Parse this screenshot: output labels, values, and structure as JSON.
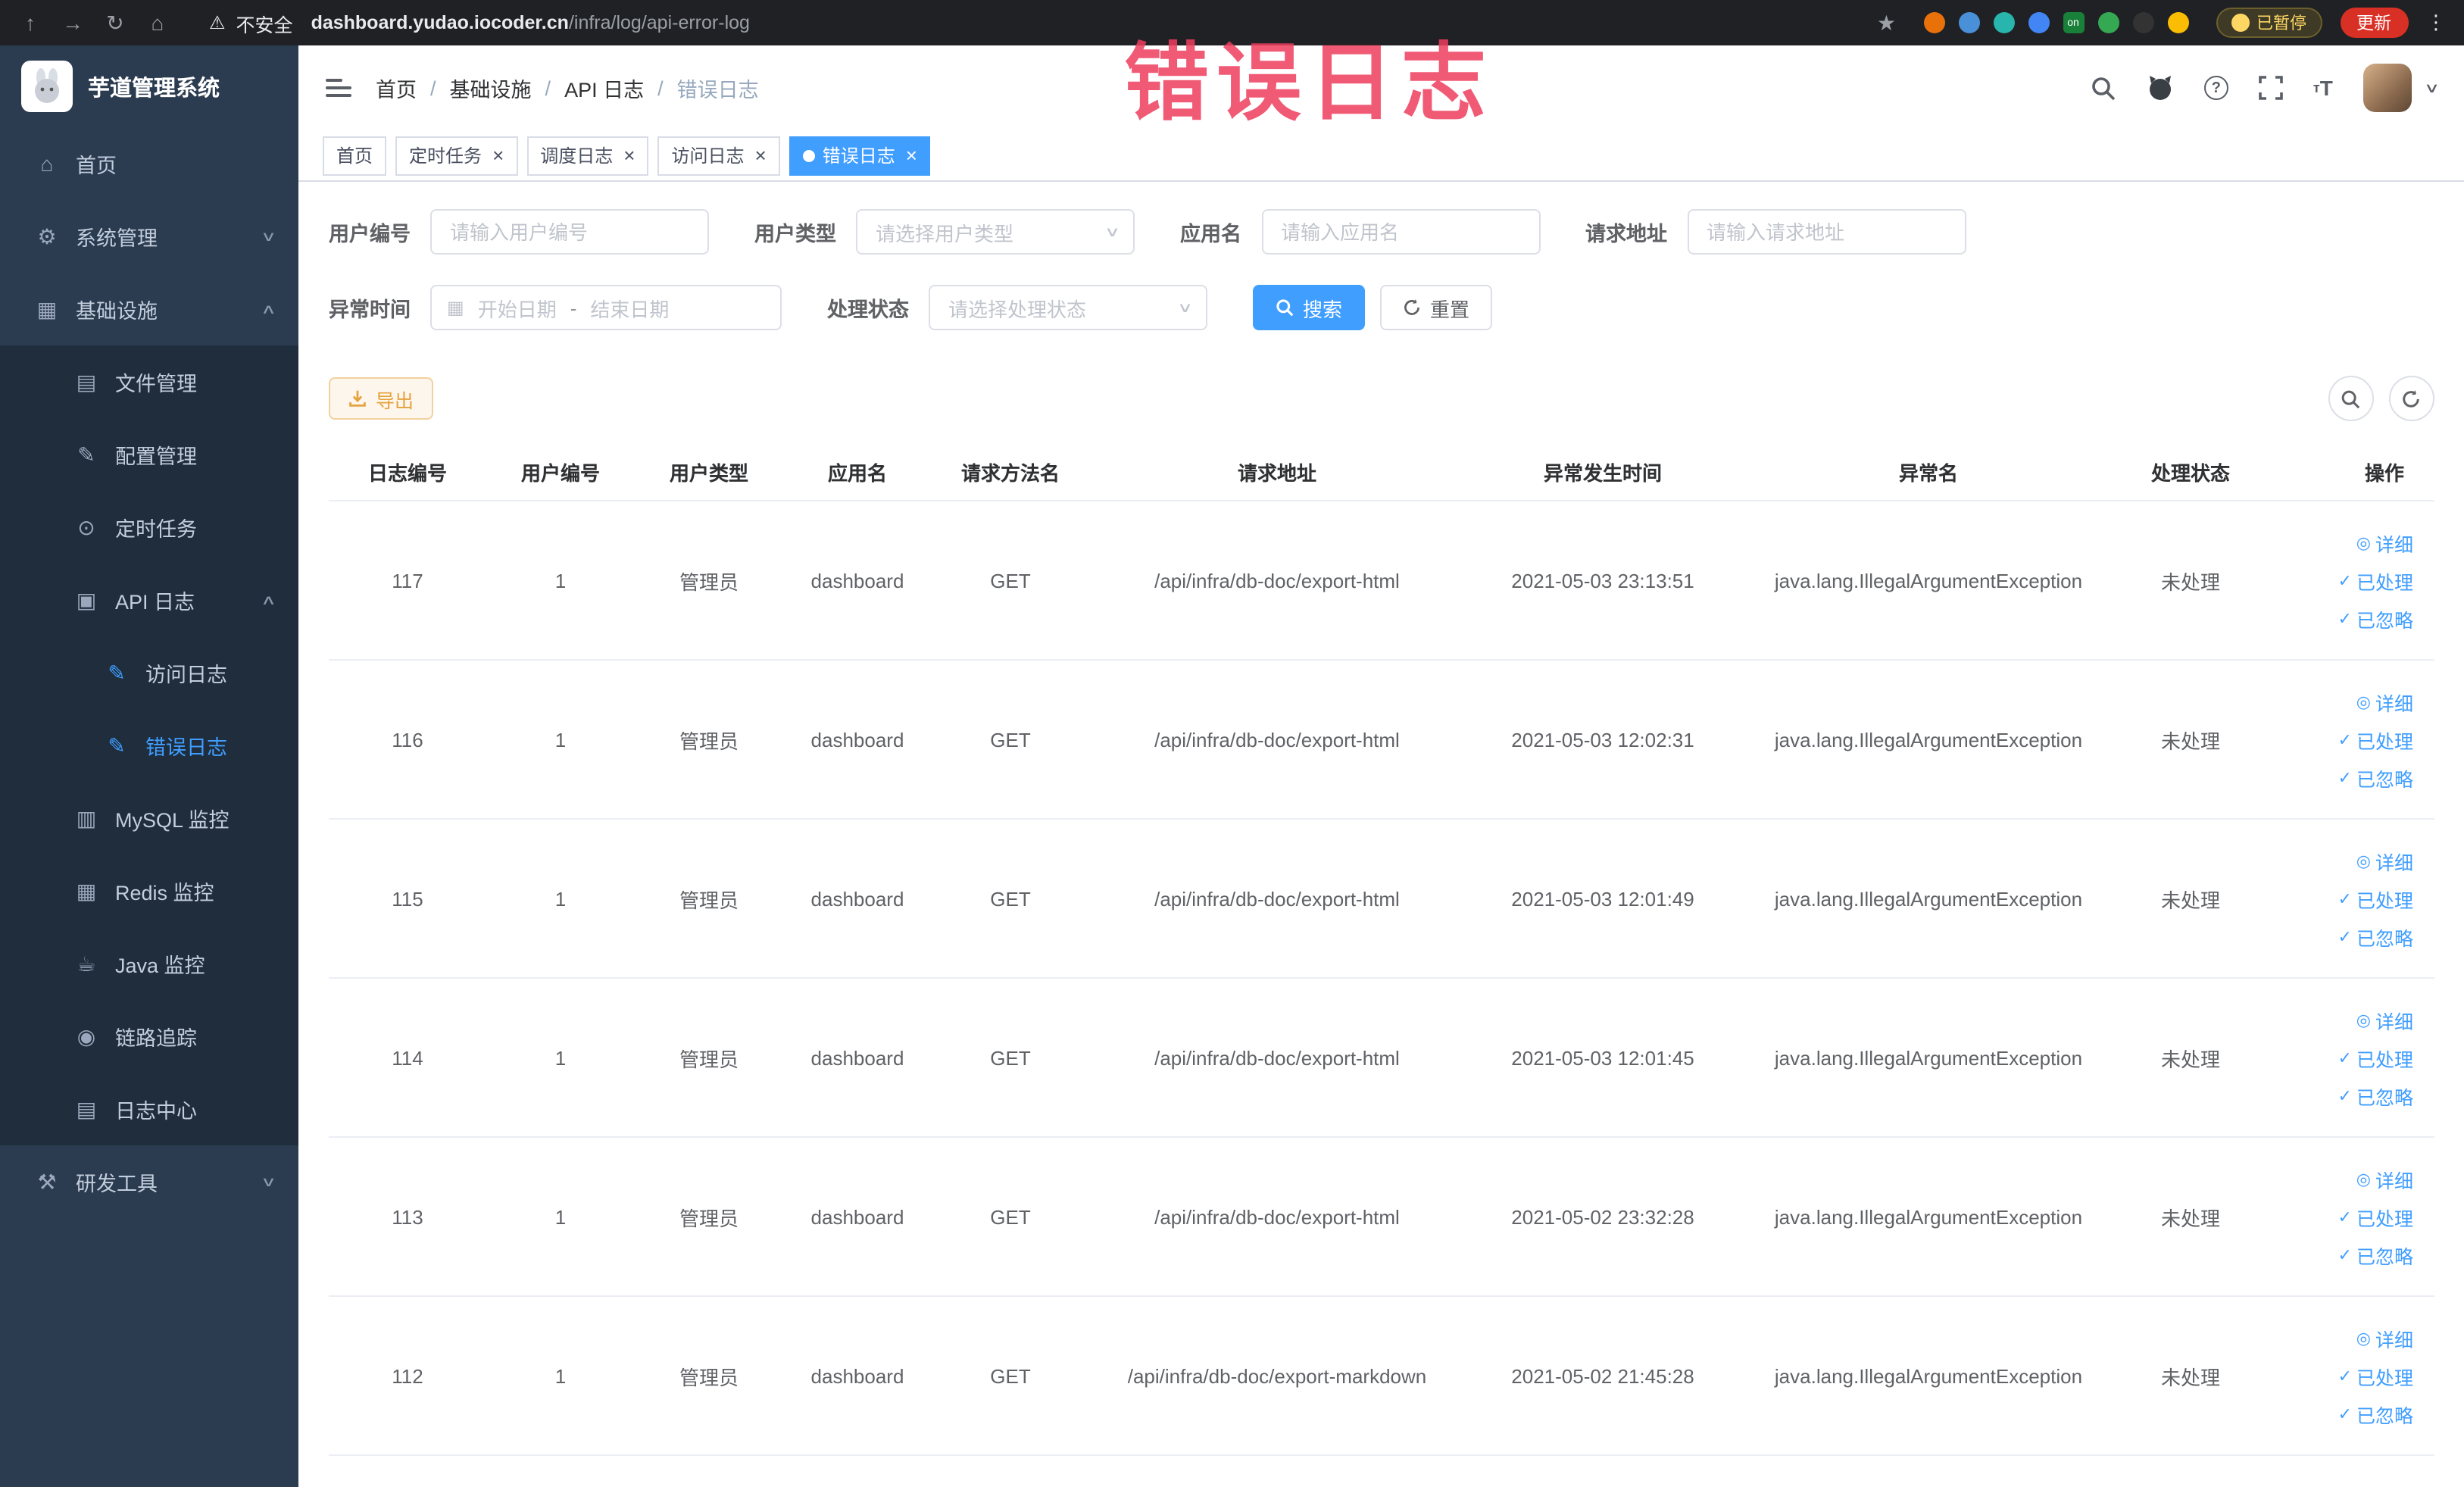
{
  "colors": {
    "accent": "#409eff",
    "sidebar_bg": "#2b3b50",
    "submenu_bg": "#1f2d3d",
    "annotation": "#ee3e5e",
    "warning": "#e6a23c",
    "chrome_bg": "#202124",
    "update_red": "#d93025"
  },
  "annotation": {
    "text": "错误日志"
  },
  "chrome": {
    "security_text": "不安全",
    "url_domain": "dashboard.yudao.iocoder.cn",
    "url_path": "/infra/log/api-error-log",
    "paused_badge": "已暂停",
    "update_button": "更新",
    "extensions": [
      {
        "color": "#e8710a",
        "shape": "circle"
      },
      {
        "color": "#4a90d9",
        "shape": "circle"
      },
      {
        "color": "#27b5ad",
        "shape": "circle"
      },
      {
        "color": "#4285f4",
        "shape": "circle"
      },
      {
        "color": "#188038",
        "shape": "square",
        "text": "on"
      },
      {
        "color": "#34a853",
        "shape": "circle"
      },
      {
        "color": "#333333",
        "shape": "circle"
      },
      {
        "color": "#fbbc04",
        "shape": "circle"
      }
    ]
  },
  "sidebar": {
    "logo_title": "芋道管理系统",
    "items": [
      {
        "id": "home",
        "label": "首页",
        "icon": "home-icon",
        "glyph": "⌂",
        "level": 0
      },
      {
        "id": "system",
        "label": "系统管理",
        "icon": "gear-icon",
        "glyph": "⚙",
        "level": 0,
        "arrow": "down"
      },
      {
        "id": "infra",
        "label": "基础设施",
        "icon": "grid-icon",
        "glyph": "▦",
        "level": 0,
        "arrow": "up"
      },
      {
        "id": "file",
        "label": "文件管理",
        "icon": "folder-icon",
        "glyph": "▤",
        "level": 1,
        "sub": true
      },
      {
        "id": "config",
        "label": "配置管理",
        "icon": "pencil-icon",
        "glyph": "✎",
        "level": 1,
        "sub": true
      },
      {
        "id": "job",
        "label": "定时任务",
        "icon": "clock-icon",
        "glyph": "⊙",
        "level": 1,
        "sub": true
      },
      {
        "id": "api-log",
        "label": "API 日志",
        "icon": "log-icon",
        "glyph": "▣",
        "level": 1,
        "sub": true,
        "arrow": "up"
      },
      {
        "id": "access-log",
        "label": "访问日志",
        "icon": "edit-doc-icon",
        "glyph": "✎",
        "level": 2,
        "sub": true,
        "iconBlue": true
      },
      {
        "id": "error-log",
        "label": "错误日志",
        "icon": "edit-doc-icon",
        "glyph": "✎",
        "level": 2,
        "sub": true,
        "active": true
      },
      {
        "id": "mysql",
        "label": "MySQL 监控",
        "icon": "database-icon",
        "glyph": "▥",
        "level": 1,
        "sub": true
      },
      {
        "id": "redis",
        "label": "Redis 监控",
        "icon": "layers-icon",
        "glyph": "▦",
        "level": 1,
        "sub": true
      },
      {
        "id": "java",
        "label": "Java 监控",
        "icon": "monitor-icon",
        "glyph": "☕",
        "level": 1,
        "sub": true
      },
      {
        "id": "trace",
        "label": "链路追踪",
        "icon": "eye-icon",
        "glyph": "◉",
        "level": 1,
        "sub": true
      },
      {
        "id": "log-center",
        "label": "日志中心",
        "icon": "document-icon",
        "glyph": "▤",
        "level": 1,
        "sub": true
      },
      {
        "id": "dev-tools",
        "label": "研发工具",
        "icon": "toolbox-icon",
        "glyph": "⚒",
        "level": 0,
        "arrow": "down"
      }
    ]
  },
  "header": {
    "breadcrumb": [
      "首页",
      "基础设施",
      "API 日志",
      "错误日志"
    ]
  },
  "tabs": [
    {
      "id": "home",
      "label": "首页",
      "closable": false,
      "active": false
    },
    {
      "id": "job",
      "label": "定时任务",
      "closable": true,
      "active": false
    },
    {
      "id": "job-log",
      "label": "调度日志",
      "closable": true,
      "active": false
    },
    {
      "id": "access-log",
      "label": "访问日志",
      "closable": true,
      "active": false
    },
    {
      "id": "error-log",
      "label": "错误日志",
      "closable": true,
      "active": true
    }
  ],
  "filters": {
    "user_id_label": "用户编号",
    "user_id_placeholder": "请输入用户编号",
    "user_type_label": "用户类型",
    "user_type_placeholder": "请选择用户类型",
    "app_name_label": "应用名",
    "app_name_placeholder": "请输入应用名",
    "request_url_label": "请求地址",
    "request_url_placeholder": "请输入请求地址",
    "exception_time_label": "异常时间",
    "start_date_placeholder": "开始日期",
    "end_date_placeholder": "结束日期",
    "date_separator": "-",
    "process_status_label": "处理状态",
    "process_status_placeholder": "请选择处理状态",
    "search_label": "搜索",
    "reset_label": "重置"
  },
  "toolbar": {
    "export_label": "导出"
  },
  "table": {
    "columns": [
      "日志编号",
      "用户编号",
      "用户类型",
      "应用名",
      "请求方法名",
      "请求地址",
      "异常发生时间",
      "异常名",
      "处理状态",
      "操作"
    ],
    "row_actions": [
      "详细",
      "已处理",
      "已忽略"
    ],
    "rows": [
      {
        "id": "117",
        "user_id": "1",
        "user_type": "管理员",
        "app": "dashboard",
        "method": "GET",
        "url": "/api/infra/db-doc/export-html",
        "time": "2021-05-03 23:13:51",
        "exception": "java.lang.IllegalArgumentException",
        "status": "未处理"
      },
      {
        "id": "116",
        "user_id": "1",
        "user_type": "管理员",
        "app": "dashboard",
        "method": "GET",
        "url": "/api/infra/db-doc/export-html",
        "time": "2021-05-03 12:02:31",
        "exception": "java.lang.IllegalArgumentException",
        "status": "未处理"
      },
      {
        "id": "115",
        "user_id": "1",
        "user_type": "管理员",
        "app": "dashboard",
        "method": "GET",
        "url": "/api/infra/db-doc/export-html",
        "time": "2021-05-03 12:01:49",
        "exception": "java.lang.IllegalArgumentException",
        "status": "未处理"
      },
      {
        "id": "114",
        "user_id": "1",
        "user_type": "管理员",
        "app": "dashboard",
        "method": "GET",
        "url": "/api/infra/db-doc/export-html",
        "time": "2021-05-03 12:01:45",
        "exception": "java.lang.IllegalArgumentException",
        "status": "未处理"
      },
      {
        "id": "113",
        "user_id": "1",
        "user_type": "管理员",
        "app": "dashboard",
        "method": "GET",
        "url": "/api/infra/db-doc/export-html",
        "time": "2021-05-02 23:32:28",
        "exception": "java.lang.IllegalArgumentException",
        "status": "未处理"
      },
      {
        "id": "112",
        "user_id": "1",
        "user_type": "管理员",
        "app": "dashboard",
        "method": "GET",
        "url": "/api/infra/db-doc/export-markdown",
        "time": "2021-05-02 21:45:28",
        "exception": "java.lang.IllegalArgumentException",
        "status": "未处理"
      }
    ]
  }
}
